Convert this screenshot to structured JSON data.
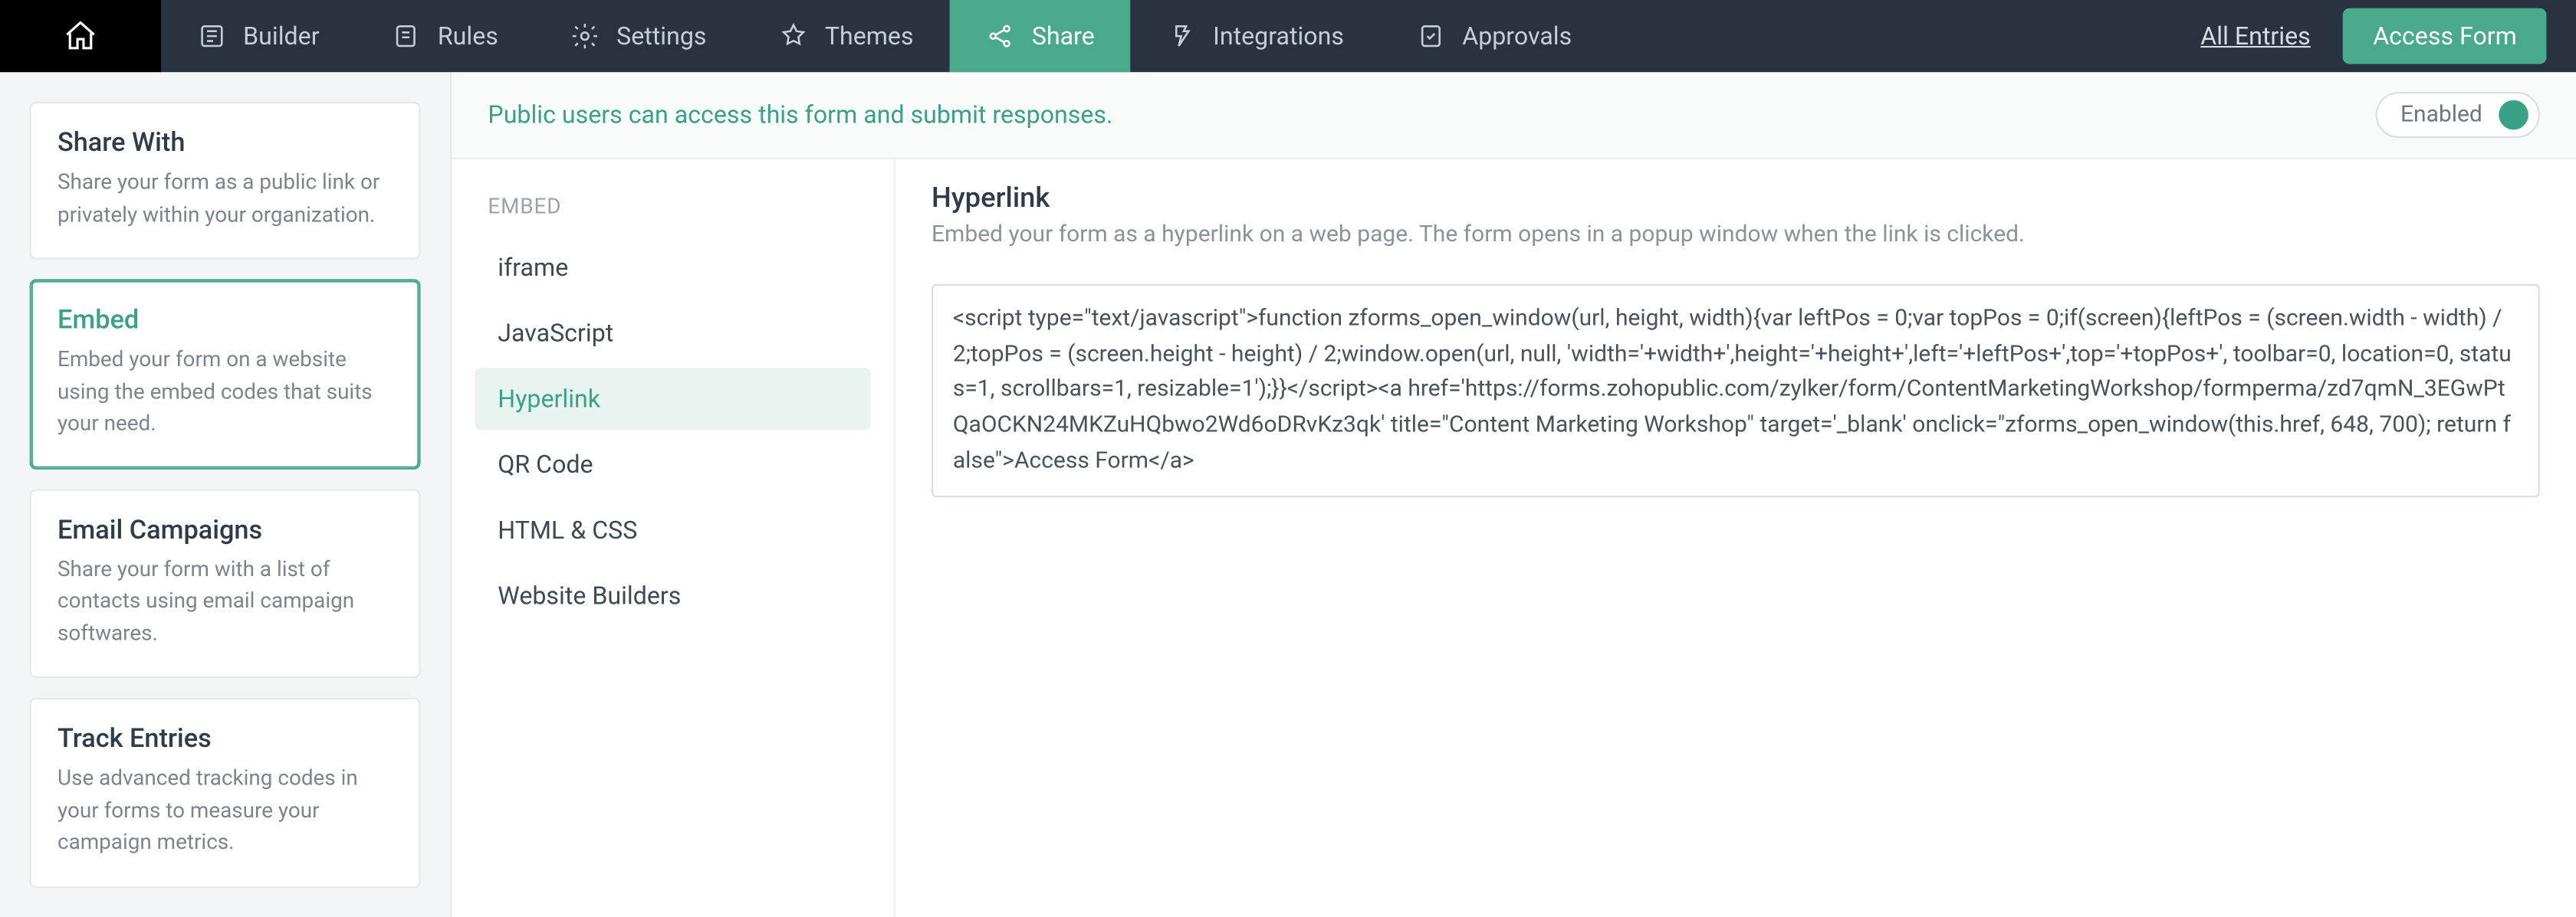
{
  "topnav": {
    "tabs": [
      {
        "id": "builder",
        "label": "Builder"
      },
      {
        "id": "rules",
        "label": "Rules"
      },
      {
        "id": "settings",
        "label": "Settings"
      },
      {
        "id": "themes",
        "label": "Themes"
      },
      {
        "id": "share",
        "label": "Share"
      },
      {
        "id": "integrations",
        "label": "Integrations"
      },
      {
        "id": "approvals",
        "label": "Approvals"
      }
    ],
    "all_entries": "All Entries",
    "access_form": "Access Form"
  },
  "sidebar": {
    "share_with": {
      "title": "Share With",
      "desc": "Share your form as a public link or privately within your organization."
    },
    "embed": {
      "title": "Embed",
      "desc": "Embed your form on a website using the embed codes that suits your need."
    },
    "email_campaigns": {
      "title": "Email Campaigns",
      "desc": "Share your form with a list of contacts using email campaign softwares."
    },
    "track_entries": {
      "title": "Track Entries",
      "desc": "Use advanced tracking codes in your forms to measure your campaign metrics."
    }
  },
  "notice": {
    "text": "Public users can access this form and submit responses.",
    "toggle_label": "Enabled"
  },
  "embed": {
    "heading": "EMBED",
    "items": [
      "iframe",
      "JavaScript",
      "Hyperlink",
      "QR Code",
      "HTML & CSS",
      "Website Builders"
    ]
  },
  "detail": {
    "title": "Hyperlink",
    "desc": "Embed your form as a hyperlink on a web page. The form opens in a popup window when the link is clicked.",
    "code": "<script type=\"text/javascript\">function zforms_open_window(url, height, width){var leftPos = 0;var topPos = 0;if(screen){leftPos = (screen.width - width) / 2;topPos = (screen.height - height) / 2;window.open(url, null, 'width='+width+',height='+height+',left='+leftPos+',top='+topPos+', toolbar=0, location=0, status=1, scrollbars=1, resizable=1');}}</script><a href='https://forms.zohopublic.com/zylker/form/ContentMarketingWorkshop/formperma/zd7qmN_3EGwPtQaOCKN24MKZuHQbwo2Wd6oDRvKz3qk' title=\"Content Marketing Workshop\" target='_blank' onclick=\"zforms_open_window(this.href, 648, 700); return false\">Access Form</a>"
  },
  "colors": {
    "accent": "#49a98b",
    "nav_bg": "#28333f"
  }
}
